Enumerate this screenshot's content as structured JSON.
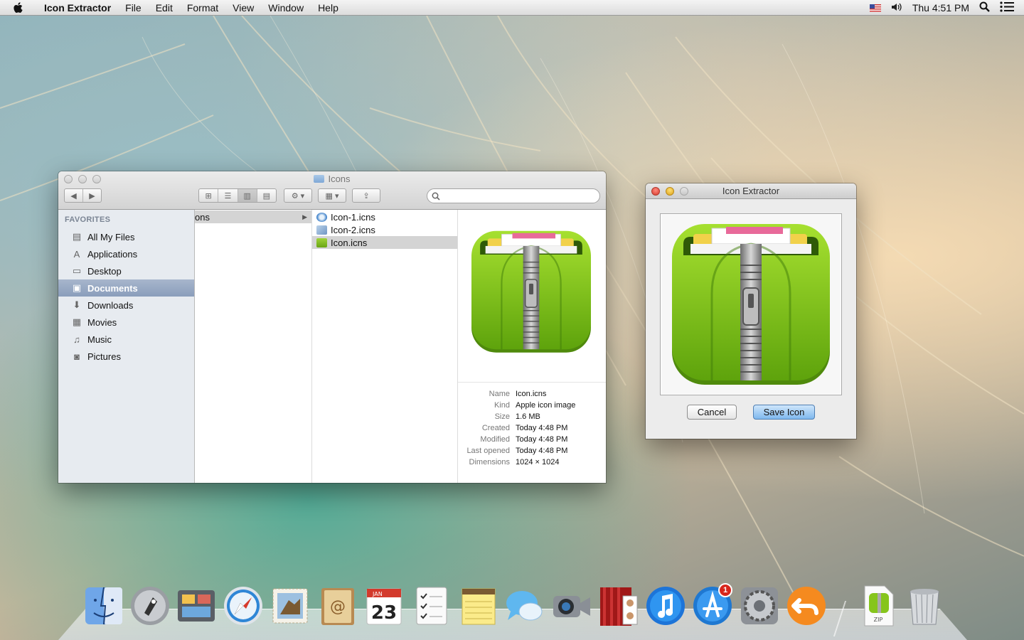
{
  "menubar": {
    "app_name": "Icon Extractor",
    "menus": [
      "File",
      "Edit",
      "Format",
      "View",
      "Window",
      "Help"
    ],
    "clock": "Thu 4:51 PM"
  },
  "finder": {
    "title": "Icons",
    "sidebar_heading": "FAVORITES",
    "sidebar_items": [
      {
        "label": "All My Files",
        "icon": "all-files-icon"
      },
      {
        "label": "Applications",
        "icon": "applications-icon"
      },
      {
        "label": "Desktop",
        "icon": "desktop-icon"
      },
      {
        "label": "Documents",
        "icon": "documents-icon",
        "selected": true
      },
      {
        "label": "Downloads",
        "icon": "downloads-icon"
      },
      {
        "label": "Movies",
        "icon": "movies-icon"
      },
      {
        "label": "Music",
        "icon": "music-icon"
      },
      {
        "label": "Pictures",
        "icon": "pictures-icon"
      }
    ],
    "column1_crumb": "ons",
    "files": [
      {
        "name": "Icon-1.icns",
        "icon": "safari-file-icon"
      },
      {
        "name": "Icon-2.icns",
        "icon": "image-file-icon"
      },
      {
        "name": "Icon.icns",
        "icon": "zip-file-icon",
        "selected": true
      }
    ],
    "info": [
      {
        "key": "Name",
        "value": "Icon.icns"
      },
      {
        "key": "Kind",
        "value": "Apple icon image"
      },
      {
        "key": "Size",
        "value": "1.6 MB"
      },
      {
        "key": "Created",
        "value": "Today 4:48 PM"
      },
      {
        "key": "Modified",
        "value": "Today 4:48 PM"
      },
      {
        "key": "Last opened",
        "value": "Today 4:48 PM"
      },
      {
        "key": "Dimensions",
        "value": "1024 × 1024"
      }
    ]
  },
  "extractor": {
    "title": "Icon Extractor",
    "cancel_label": "Cancel",
    "save_label": "Save Icon"
  },
  "dock": {
    "badge_count": "1",
    "calendar_month": "JAN",
    "calendar_day": "23",
    "zip_label": "ZIP",
    "items": [
      "finder",
      "launchpad",
      "mission-control",
      "safari",
      "mail",
      "contacts",
      "calendar",
      "reminders",
      "notes",
      "messages",
      "facetime",
      "photo-booth",
      "itunes",
      "app-store",
      "system-preferences",
      "back",
      "zip-document",
      "trash"
    ]
  },
  "colors": {
    "icon_green": "#86c51c",
    "selection_blue": "#8a9ebb"
  }
}
